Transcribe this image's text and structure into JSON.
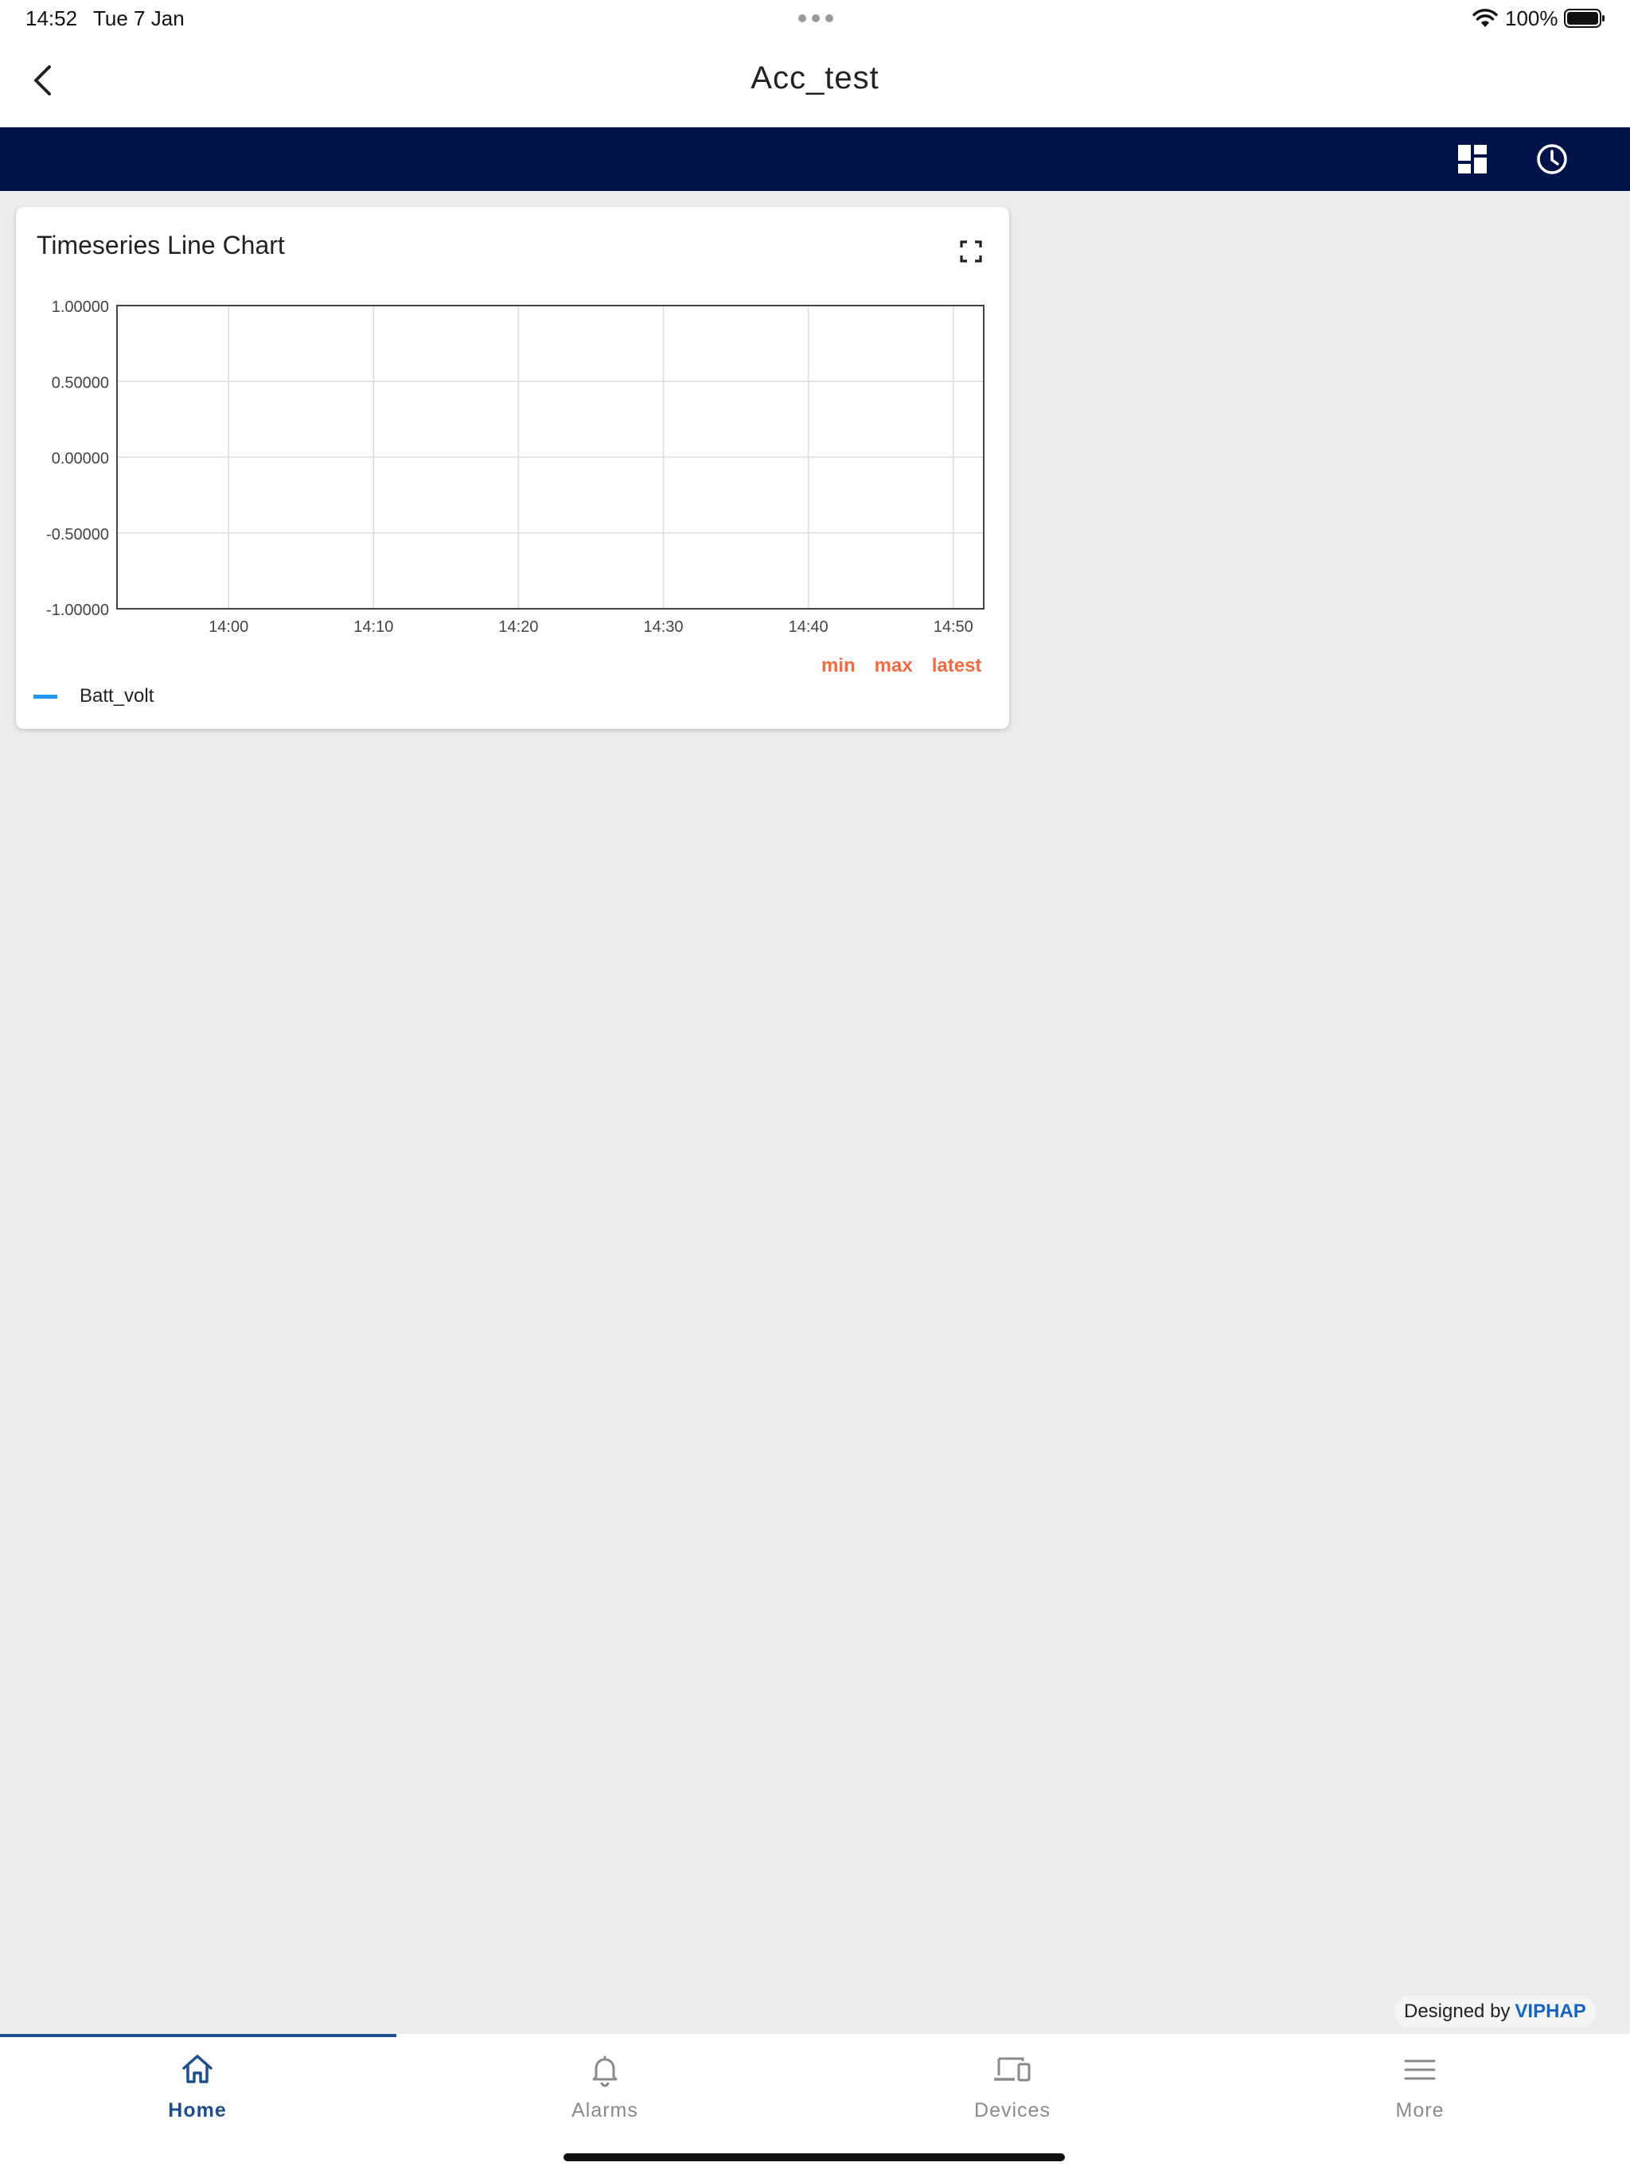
{
  "status_bar": {
    "time": "14:52",
    "date": "Tue 7 Jan",
    "battery": "100%"
  },
  "header": {
    "title": "Acc_test",
    "back_icon": "chevron-left-icon"
  },
  "toolbar": {
    "background": "#00124a",
    "icons": [
      "dashboard-icon",
      "clock-icon"
    ]
  },
  "card": {
    "title": "Timeseries Line Chart",
    "fullscreen_icon": "fullscreen-icon",
    "stats": {
      "min": "min",
      "max": "max",
      "latest": "latest"
    },
    "stat_color": "#f26a3d"
  },
  "chart_data": {
    "type": "line",
    "title": "Timeseries Line Chart",
    "x_ticks": [
      "14:00",
      "14:10",
      "14:20",
      "14:30",
      "14:40",
      "14:50"
    ],
    "y_ticks": [
      "1.00000",
      "0.50000",
      "0.00000",
      "-0.50000",
      "-1.00000"
    ],
    "ylim": [
      -1,
      1
    ],
    "grid": true,
    "legend_position": "bottom-left",
    "series": [
      {
        "name": "Batt_volt",
        "color": "#2196f3",
        "values": []
      }
    ]
  },
  "credit": {
    "prefix": "Designed by",
    "brand": "VIPHAP"
  },
  "bottom_nav": {
    "items": [
      {
        "label": "Home",
        "icon": "home-icon",
        "active": true
      },
      {
        "label": "Alarms",
        "icon": "bell-icon",
        "active": false
      },
      {
        "label": "Devices",
        "icon": "devices-icon",
        "active": false
      },
      {
        "label": "More",
        "icon": "menu-icon",
        "active": false
      }
    ]
  }
}
